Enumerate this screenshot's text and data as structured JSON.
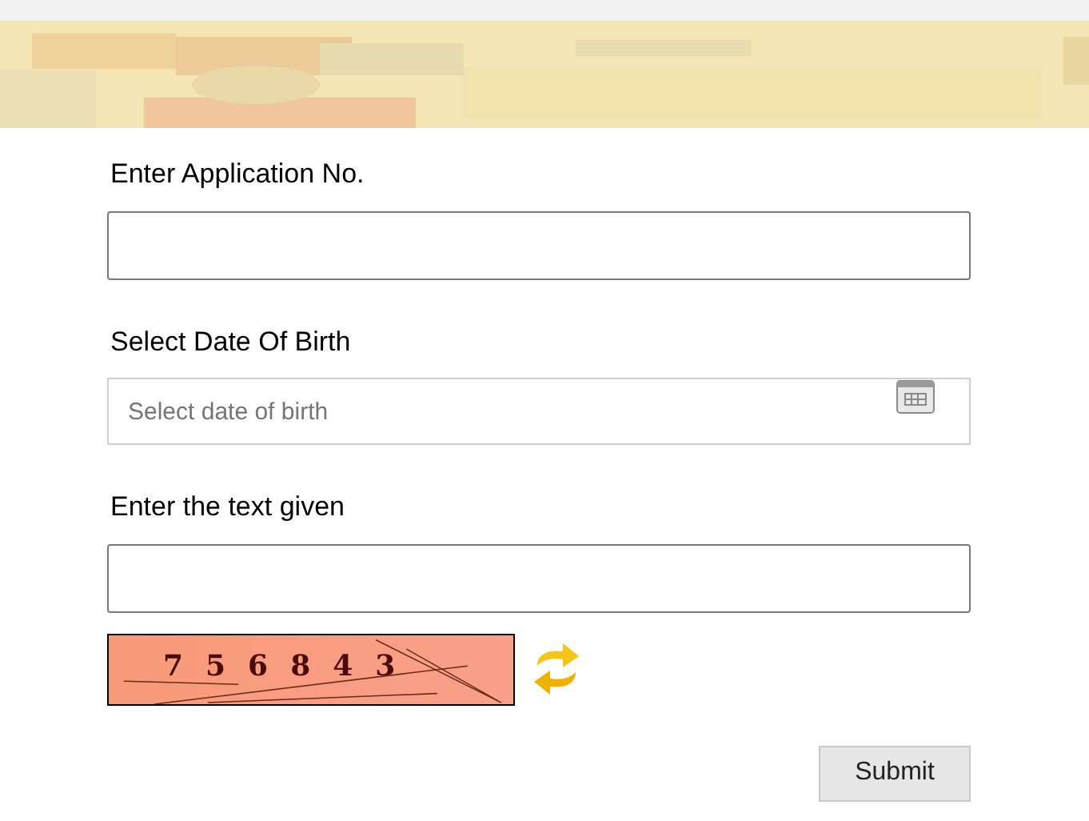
{
  "fields": [
    {
      "kind": "text",
      "label": "Enter Application No."
    },
    {
      "kind": "date",
      "label": "Select Date Of Birth",
      "placeholder": "Select date of birth"
    },
    {
      "kind": "text",
      "label": "Enter the text given"
    }
  ],
  "captcha": {
    "text": "756843"
  },
  "submit": "Submit"
}
